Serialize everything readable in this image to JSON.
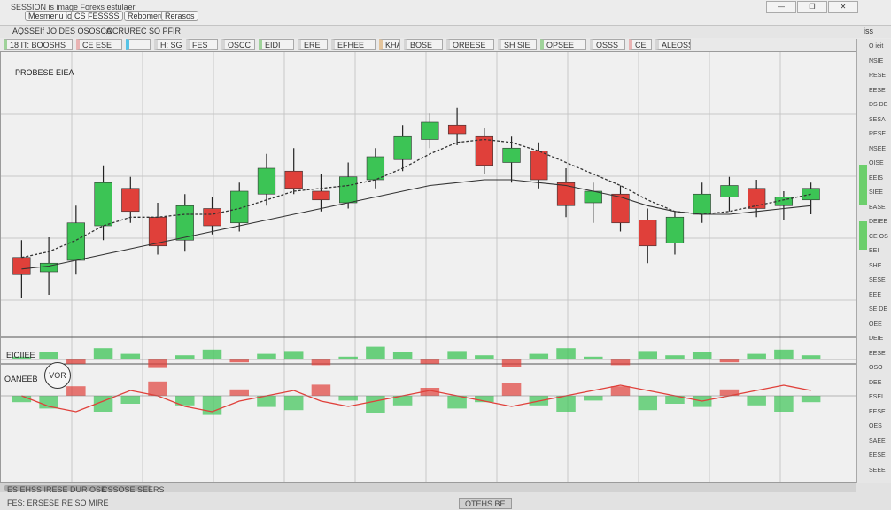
{
  "window": {
    "title": "SESSION is image Forexs estulaer",
    "menu": [
      "Mesmenu io",
      "CS FESSSS",
      "Rebomeru",
      "Rerasos"
    ],
    "controls": [
      "—",
      "❐",
      "✕"
    ]
  },
  "toolbar": {
    "items": [
      "AQSSEIf JO DES OSOSCA",
      "OCRUREC SO PFIR",
      "iss"
    ]
  },
  "tabs": [
    {
      "label": "18 IT: BOOSHS",
      "accent": "#9fd39a"
    },
    {
      "label": "CE ESE",
      "accent": "#e9b3b3"
    },
    {
      "label": "",
      "accent": "#56c3e6"
    },
    {
      "label": "H: SG",
      "accent": "#d5d5d5"
    },
    {
      "label": "FES",
      "accent": "#d5d5d5"
    },
    {
      "label": "OSCC",
      "accent": "#d5d5d5"
    },
    {
      "label": "EIDI",
      "accent": "#9fd39a"
    },
    {
      "label": "ERE",
      "accent": "#d5d5d5"
    },
    {
      "label": "EFHEE",
      "accent": "#d5d5d5"
    },
    {
      "label": "KHAA",
      "accent": "#e4c49b"
    },
    {
      "label": "BOSE",
      "accent": "#d5d5d5"
    },
    {
      "label": "ORBESE",
      "accent": "#d5d5d5"
    },
    {
      "label": "SH SIE",
      "accent": "#d5d5d5"
    },
    {
      "label": "OPSEE",
      "accent": "#9fd39a"
    },
    {
      "label": "OSSS",
      "accent": "#d5d5d5"
    },
    {
      "label": "CE",
      "accent": "#e9b3b3"
    },
    {
      "label": "ALEOSS",
      "accent": "#d5d5d5"
    }
  ],
  "chart": {
    "main_label": "PROBESE EIEA",
    "badge_label": "VOR",
    "indicator1_label": "EIOIIEE",
    "indicator2_label": "OANEEB"
  },
  "colors": {
    "bull": "#3cc455",
    "bear": "#e0403a",
    "ma": "#333333",
    "grid": "#c7c7c7"
  },
  "chart_data": {
    "type": "candlestick",
    "candles": [
      {
        "o": 46,
        "h": 52,
        "l": 32,
        "c": 40
      },
      {
        "o": 41,
        "h": 53,
        "l": 33,
        "c": 44
      },
      {
        "o": 45,
        "h": 64,
        "l": 40,
        "c": 58
      },
      {
        "o": 57,
        "h": 78,
        "l": 52,
        "c": 72
      },
      {
        "o": 70,
        "h": 74,
        "l": 58,
        "c": 62
      },
      {
        "o": 60,
        "h": 65,
        "l": 47,
        "c": 50
      },
      {
        "o": 52,
        "h": 68,
        "l": 48,
        "c": 64
      },
      {
        "o": 63,
        "h": 67,
        "l": 54,
        "c": 57
      },
      {
        "o": 58,
        "h": 72,
        "l": 55,
        "c": 69
      },
      {
        "o": 68,
        "h": 82,
        "l": 64,
        "c": 77
      },
      {
        "o": 76,
        "h": 84,
        "l": 68,
        "c": 70
      },
      {
        "o": 69,
        "h": 75,
        "l": 62,
        "c": 66
      },
      {
        "o": 65,
        "h": 79,
        "l": 63,
        "c": 74
      },
      {
        "o": 73,
        "h": 84,
        "l": 70,
        "c": 81
      },
      {
        "o": 80,
        "h": 92,
        "l": 76,
        "c": 88
      },
      {
        "o": 87,
        "h": 96,
        "l": 84,
        "c": 93
      },
      {
        "o": 92,
        "h": 98,
        "l": 85,
        "c": 89
      },
      {
        "o": 88,
        "h": 91,
        "l": 75,
        "c": 78
      },
      {
        "o": 79,
        "h": 88,
        "l": 72,
        "c": 84
      },
      {
        "o": 83,
        "h": 86,
        "l": 70,
        "c": 73
      },
      {
        "o": 72,
        "h": 77,
        "l": 60,
        "c": 64
      },
      {
        "o": 65,
        "h": 72,
        "l": 58,
        "c": 69
      },
      {
        "o": 68,
        "h": 71,
        "l": 55,
        "c": 58
      },
      {
        "o": 59,
        "h": 63,
        "l": 44,
        "c": 50
      },
      {
        "o": 51,
        "h": 62,
        "l": 47,
        "c": 60
      },
      {
        "o": 61,
        "h": 72,
        "l": 58,
        "c": 68
      },
      {
        "o": 67,
        "h": 74,
        "l": 62,
        "c": 71
      },
      {
        "o": 70,
        "h": 73,
        "l": 60,
        "c": 63
      },
      {
        "o": 64,
        "h": 69,
        "l": 59,
        "c": 67
      },
      {
        "o": 66,
        "h": 72,
        "l": 61,
        "c": 70
      }
    ],
    "ma_fast": [
      46,
      48,
      52,
      57,
      60,
      60,
      61,
      61,
      63,
      66,
      69,
      70,
      71,
      73,
      77,
      82,
      86,
      87,
      86,
      83,
      79,
      75,
      71,
      66,
      62,
      61,
      62,
      64,
      66,
      68
    ],
    "ma_slow": [
      42,
      43,
      45,
      47,
      49,
      51,
      53,
      55,
      57,
      59,
      61,
      63,
      65,
      67,
      69,
      71,
      72,
      73,
      73,
      72,
      71,
      69,
      67,
      64,
      62,
      61,
      61,
      62,
      63,
      64
    ],
    "ylim": [
      25,
      105
    ],
    "osc1": [
      2,
      5,
      -3,
      8,
      4,
      -6,
      3,
      7,
      -2,
      4,
      6,
      -4,
      2,
      9,
      5,
      -3,
      6,
      3,
      -5,
      4,
      8,
      2,
      -4,
      6,
      3,
      5,
      -2,
      4,
      7,
      3
    ],
    "osc2": [
      -4,
      -8,
      6,
      -10,
      -5,
      9,
      -6,
      -12,
      4,
      -7,
      -9,
      7,
      -3,
      -11,
      -6,
      5,
      -8,
      -4,
      8,
      -6,
      -10,
      -3,
      6,
      -9,
      -5,
      -7,
      4,
      -6,
      -10,
      -4
    ],
    "osc2_line": [
      0,
      -2,
      -3,
      -1,
      1,
      0,
      -2,
      -3,
      -1,
      0,
      1,
      -1,
      -2,
      -1,
      0,
      1,
      0,
      -1,
      -2,
      -1,
      0,
      1,
      2,
      1,
      0,
      -1,
      0,
      1,
      2,
      1
    ]
  },
  "right_panel": {
    "items": [
      "O ieit",
      "NSIE",
      "RESE",
      "EESE",
      "DS DE",
      "SESA",
      "RESE",
      "NSEE",
      "OISE",
      "EEIS",
      "SIEE",
      "BASE",
      "DEIEE",
      "CE OS",
      "EEI",
      "SHE",
      "SESE",
      "EEE",
      "SE DE",
      "OEE",
      "DEIE",
      "EESE",
      "OSO",
      "DEE",
      "ESEI",
      "EESE",
      "OES",
      "SAEE",
      "EESE",
      "SEEE"
    ]
  },
  "status": {
    "left": "ES EHSS IRESE DUR OSE",
    "middle": "CSSOSE SEERS",
    "bottom_left": "FES: ERSESE RE SO MIRE",
    "center": "OTEHS BE"
  }
}
